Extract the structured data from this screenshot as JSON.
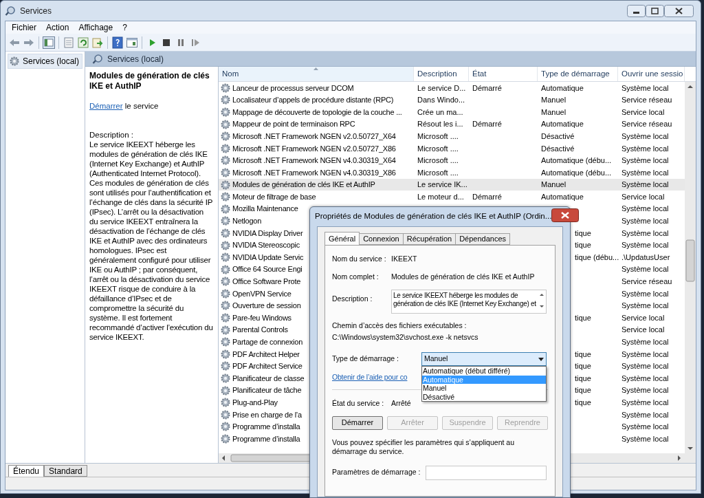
{
  "window": {
    "title": "Services"
  },
  "menu": [
    {
      "label": "Fichier"
    },
    {
      "label": "Action"
    },
    {
      "label": "Affichage"
    },
    {
      "label": "?"
    }
  ],
  "tree": [
    {
      "label": "Services (local)",
      "selected": true
    }
  ],
  "pane_header": "Services (local)",
  "details": {
    "title": "Modules de génération de clés IKE et AuthIP",
    "action_link": "Démarrer",
    "action_text": "le service",
    "description_label": "Description :",
    "description": "Le service IKEEXT héberge les modules de génération de clés IKE (Internet Key Exchange) et AuthIP (Authenticated Internet Protocol). Ces modules de génération de clés sont utilisés pour l’authentification et l’échange de clés dans la sécurité IP (IPsec). L’arrêt ou la désactivation du service IKEEXT entraînera la désactivation de l’échange de clés IKE et AuthIP avec des ordinateurs homologues. IPsec est généralement configuré pour utiliser IKE ou AuthIP ; par conséquent, l’arrêt ou la désactivation du service IKEEXT risque de conduire à la défaillance d’IPsec et de compromettre la sécurité du système. Il est fortement recommandé d’activer l’exécution du service IKEEXT."
  },
  "table": {
    "columns": [
      {
        "label": "Nom",
        "sorted": true
      },
      {
        "label": "Description",
        "sorted": false
      },
      {
        "label": "État",
        "sorted": false
      },
      {
        "label": "Type de démarrage",
        "sorted": false
      },
      {
        "label": "Ouvrir une sessio",
        "sorted": false
      }
    ],
    "rows": [
      {
        "selected": false,
        "name": "Lanceur de processus serveur DCOM",
        "description": "Le service D...",
        "state": "Démarré",
        "startup": "Automatique",
        "logon": "Système local"
      },
      {
        "selected": false,
        "name": "Localisateur d’appels de procédure distante (RPC)",
        "description": "Dans Windo...",
        "startup": "Manuel",
        "logon": "Service réseau"
      },
      {
        "selected": false,
        "name": "Mappage de découverte de topologie de la couche ...",
        "description": "Crée un ma...",
        "startup": "Manuel",
        "logon": "Service local"
      },
      {
        "selected": false,
        "name": "Mappeur de point de terminaison RPC",
        "description": "Résout les i...",
        "state": "Démarré",
        "startup": "Automatique",
        "logon": "Service réseau"
      },
      {
        "selected": false,
        "name": "Microsoft .NET Framework NGEN v2.0.50727_X64",
        "description": "Microsoft ....",
        "startup": "Désactivé",
        "logon": "Système local"
      },
      {
        "selected": false,
        "name": "Microsoft .NET Framework NGEN v2.0.50727_X86",
        "description": "Microsoft ....",
        "startup": "Désactivé",
        "logon": "Système local"
      },
      {
        "selected": false,
        "name": "Microsoft .NET Framework NGEN v4.0.30319_X64",
        "description": "Microsoft ....",
        "startup": "Automatique (débu...",
        "logon": "Système local"
      },
      {
        "selected": false,
        "name": "Microsoft .NET Framework NGEN v4.0.30319_X86",
        "description": "Microsoft ....",
        "startup": "Automatique (débu...",
        "logon": "Système local"
      },
      {
        "selected": true,
        "name": "Modules de génération de clés IKE et AuthIP",
        "description": "Le service IK...",
        "startup": "Manuel",
        "logon": "Système local"
      },
      {
        "selected": false,
        "name": "Moteur de filtrage de base",
        "description": "Le moteur d...",
        "state": "Démarré",
        "startup": "Automatique",
        "logon": "Service local"
      },
      {
        "selected": false,
        "name": "Mozilla Maintenance",
        "logon": "Système local"
      },
      {
        "selected": false,
        "name": "Netlogon",
        "logon": "Système local"
      },
      {
        "selected": false,
        "name": "NVIDIA Display Driver",
        "startup": "tique",
        "startup_cut": true,
        "logon": "Système local"
      },
      {
        "selected": false,
        "name": "NVIDIA Stereoscopic",
        "startup": "tique",
        "startup_cut": true,
        "logon": "Système local"
      },
      {
        "selected": false,
        "name": "NVIDIA Update Servic",
        "startup": "tique (débu...",
        "startup_cut": true,
        "logon": ".\\UpdatusUser"
      },
      {
        "selected": false,
        "name": "Office 64 Source Engi",
        "logon": "Système local"
      },
      {
        "selected": false,
        "name": "Office Software Prote",
        "logon": "Service réseau"
      },
      {
        "selected": false,
        "name": "OpenVPN Service",
        "logon": "Système local"
      },
      {
        "selected": false,
        "name": "Ouverture de session",
        "logon": "Système local"
      },
      {
        "selected": false,
        "name": "Pare-feu Windows",
        "startup": "tique",
        "startup_cut": true,
        "logon": "Service local"
      },
      {
        "selected": false,
        "name": "Parental Controls",
        "logon": "Service local"
      },
      {
        "selected": false,
        "name": "Partage de connexion",
        "logon": "Système local"
      },
      {
        "selected": false,
        "name": "PDF Architect Helper",
        "startup": "tique",
        "startup_cut": true,
        "logon": "Système local"
      },
      {
        "selected": false,
        "name": "PDF Architect Service",
        "startup": "tique",
        "startup_cut": true,
        "logon": "Système local"
      },
      {
        "selected": false,
        "name": "Planificateur de classe",
        "startup": "tique",
        "startup_cut": true,
        "logon": "Système local"
      },
      {
        "selected": false,
        "name": "Planificateur de tâche",
        "startup": "tique",
        "startup_cut": true,
        "logon": "Système local"
      },
      {
        "selected": false,
        "name": "Plug-and-Play",
        "startup": "tique",
        "startup_cut": true,
        "logon": "Système local"
      },
      {
        "selected": false,
        "name": "Prise en charge de l’a",
        "logon": "Système local"
      },
      {
        "selected": false,
        "name": "Programme d’installa",
        "logon": "Système local"
      },
      {
        "selected": false,
        "name": "Programme d’installa",
        "logon": "Système local"
      }
    ]
  },
  "view_tabs": [
    {
      "label": "Étendu",
      "selected": true
    },
    {
      "label": "Standard",
      "selected": false
    }
  ],
  "dialog": {
    "title": "Propriétés de Modules de génération de clés IKE et AuthIP (Ordin...",
    "tabs": [
      {
        "label": "Général",
        "selected": true
      },
      {
        "label": "Connexion",
        "selected": false
      },
      {
        "label": "Récupération",
        "selected": false
      },
      {
        "label": "Dépendances",
        "selected": false
      }
    ],
    "service_name_label": "Nom du service :",
    "service_name": "IKEEXT",
    "display_name_label": "Nom complet :",
    "display_name": "Modules de génération de clés IKE et AuthIP",
    "description_label": "Description :",
    "description": "Le service IKEEXT héberge les modules de génération de clés IKE (Internet Key Exchange) et",
    "path_label": "Chemin d’accès des fichiers exécutables :",
    "path": "C:\\Windows\\system32\\svchost.exe -k netsvcs",
    "startup_label": "Type de démarrage :",
    "startup_value": "Manuel",
    "startup_open": true,
    "startup_options": [
      {
        "label": "Automatique (début différé)",
        "selected": false
      },
      {
        "label": "Automatique",
        "selected": true
      },
      {
        "label": "Manuel",
        "selected": false
      },
      {
        "label": "Désactivé",
        "selected": false
      }
    ],
    "help_link": "Obtenir de l’aide pour co",
    "status_label": "État du service :",
    "status": "Arrêté",
    "buttons": [
      {
        "label": "Démarrer",
        "disabled": false
      },
      {
        "label": "Arrêter",
        "disabled": true
      },
      {
        "label": "Suspendre",
        "disabled": true
      },
      {
        "label": "Reprendre",
        "disabled": true
      }
    ],
    "note": "Vous pouvez spécifier les paramètres qui s’appliquent au démarrage du service.",
    "params_label": "Paramètres de démarrage :"
  }
}
